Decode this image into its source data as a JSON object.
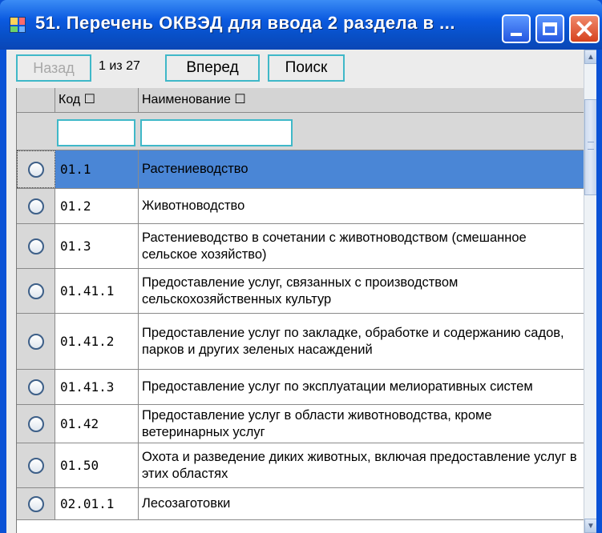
{
  "window": {
    "title": "51. Перечень ОКВЭД для ввода 2 раздела в ..."
  },
  "toolbar": {
    "back_label": "Назад",
    "page_info": "1 из 27",
    "next_label": "Вперед",
    "search_label": "Поиск"
  },
  "grid": {
    "headers": {
      "code": "Код ☐",
      "name": "Наименование ☐"
    },
    "filters": {
      "code_value": "",
      "name_value": ""
    },
    "rows": [
      {
        "code": "01.1",
        "name": "Растениеводство",
        "selected": true
      },
      {
        "code": "01.2",
        "name": "Животноводство"
      },
      {
        "code": "01.3",
        "name": "Растениеводство в сочетании с животноводством (смешанное сельское хозяйство)"
      },
      {
        "code": "01.41.1",
        "name": "Предоставление услуг, связанных с производством сельскохозяйственных культур"
      },
      {
        "code": "01.41.2",
        "name": "Предоставление услуг по закладке, обработке и содержанию садов, парков и других зеленых насаждений"
      },
      {
        "code": "01.41.3",
        "name": "Предоставление услуг по эксплуатации мелиоративных систем"
      },
      {
        "code": "01.42",
        "name": "Предоставление услуг в области животноводства, кроме ветеринарных услуг"
      },
      {
        "code": "01.50",
        "name": "Охота и разведение диких животных, включая предоставление услуг в этих областях"
      },
      {
        "code": "02.01.1",
        "name": "Лесозаготовки"
      }
    ]
  },
  "colors": {
    "titlebar": "#0b5ae0",
    "selection": "#4a86d6",
    "button_border": "#3fb8c8"
  }
}
